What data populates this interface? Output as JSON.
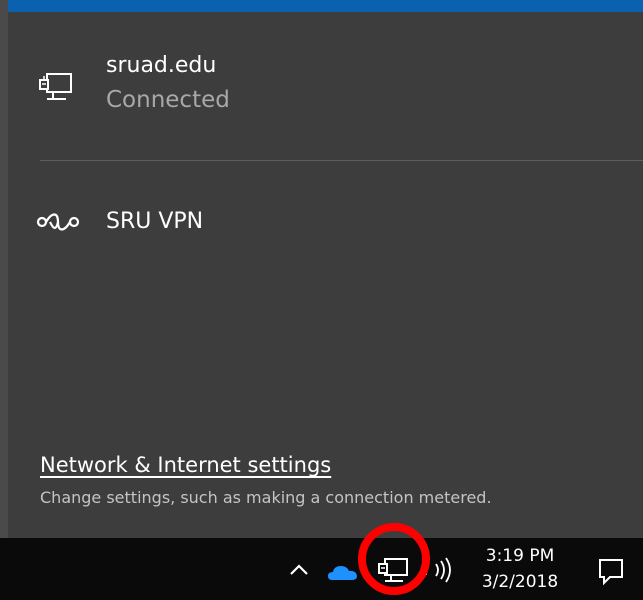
{
  "flyout": {
    "network": {
      "name": "sruad.edu",
      "status": "Connected",
      "icon": "ethernet-monitor-icon"
    },
    "vpn": {
      "name": "SRU VPN",
      "icon": "vpn-icon"
    },
    "settings": {
      "link_label": "Network & Internet settings",
      "description": "Change settings, such as making a connection metered."
    }
  },
  "taskbar": {
    "tray_icons": [
      "chevron-up-icon",
      "onedrive-cloud-icon",
      "network-icon",
      "volume-icon"
    ],
    "clock": {
      "time": "3:19 PM",
      "date": "3/2/2018"
    },
    "action_center_icon": "action-center-icon"
  },
  "colors": {
    "flyout_bg": "#3d3d3d",
    "taskbar_bg": "#0a0a0a",
    "accent_blue": "#0a61b0",
    "onedrive_blue": "#1e90ff",
    "highlight": "#ff0000"
  }
}
